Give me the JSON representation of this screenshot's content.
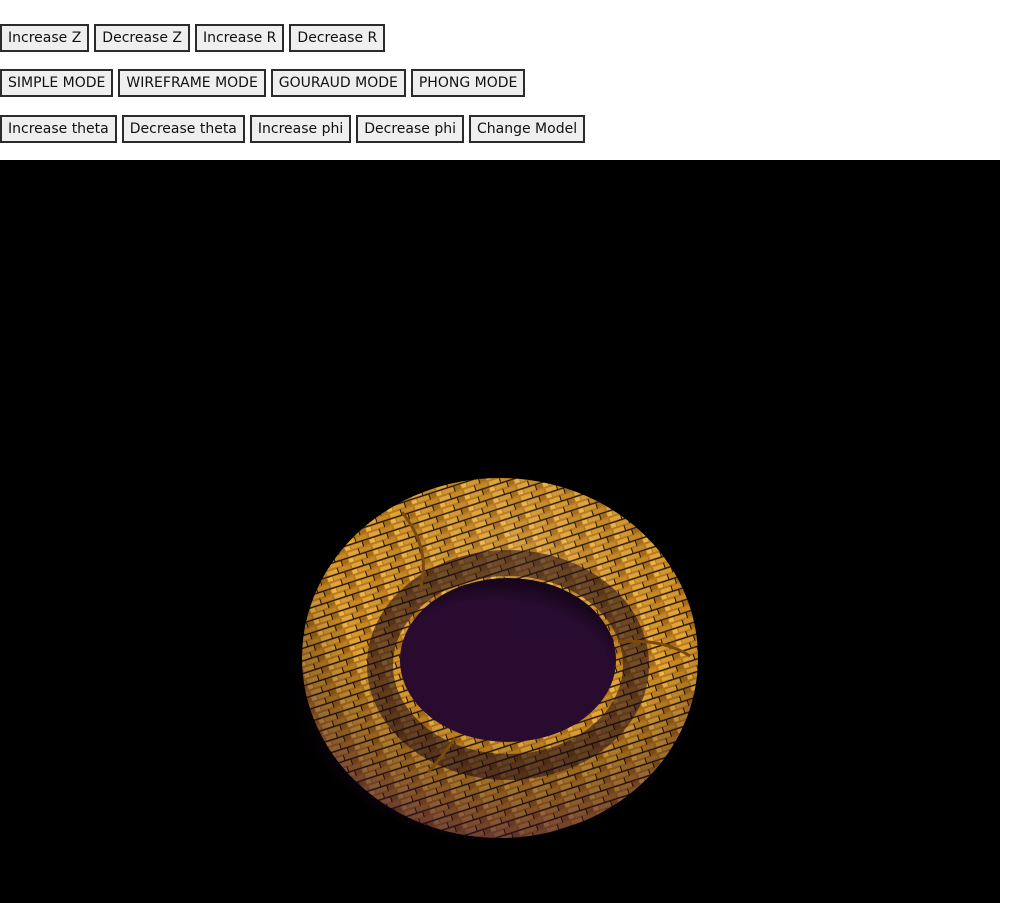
{
  "toolbar": {
    "row1": [
      "Increase Z",
      "Decrease Z",
      "Increase R",
      "Decrease R"
    ],
    "row2": [
      "SIMPLE MODE",
      "WIREFRAME MODE",
      "GOURAUD MODE",
      "PHONG MODE"
    ],
    "row3": [
      "Increase theta",
      "Decrease theta",
      "Increase phi",
      "Decrease phi",
      "Change Model"
    ]
  },
  "scene": {
    "model": "torus",
    "texture": "brick",
    "background_color": "#000000",
    "lit_color": "#d9962a",
    "shadow_color": "#3a1040"
  }
}
